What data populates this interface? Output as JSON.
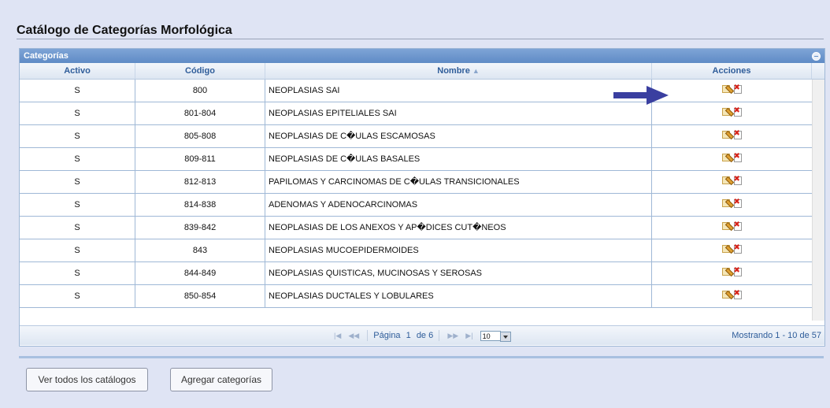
{
  "page": {
    "title": "Catálogo de Categorías Morfológica"
  },
  "grid": {
    "caption": "Categorías",
    "columns": {
      "activo": "Activo",
      "codigo": "Código",
      "nombre": "Nombre",
      "acciones": "Acciones"
    },
    "sorted_column": "nombre",
    "sort_direction": "asc",
    "rows": [
      {
        "activo": "S",
        "codigo": "800",
        "nombre": "NEOPLASIAS SAI"
      },
      {
        "activo": "S",
        "codigo": "801-804",
        "nombre": "NEOPLASIAS EPITELIALES SAI"
      },
      {
        "activo": "S",
        "codigo": "805-808",
        "nombre": "NEOPLASIAS DE C�ULAS ESCAMOSAS"
      },
      {
        "activo": "S",
        "codigo": "809-811",
        "nombre": "NEOPLASIAS DE C�ULAS BASALES"
      },
      {
        "activo": "S",
        "codigo": "812-813",
        "nombre": "PAPILOMAS Y CARCINOMAS DE C�ULAS TRANSICIONALES"
      },
      {
        "activo": "S",
        "codigo": "814-838",
        "nombre": "ADENOMAS Y ADENOCARCINOMAS"
      },
      {
        "activo": "S",
        "codigo": "839-842",
        "nombre": "NEOPLASIAS DE LOS ANEXOS Y AP�DICES CUT�NEOS"
      },
      {
        "activo": "S",
        "codigo": "843",
        "nombre": "NEOPLASIAS MUCOEPIDERMOIDES"
      },
      {
        "activo": "S",
        "codigo": "844-849",
        "nombre": "NEOPLASIAS QUISTICAS, MUCINOSAS Y SEROSAS"
      },
      {
        "activo": "S",
        "codigo": "850-854",
        "nombre": "NEOPLASIAS DUCTALES Y LOBULARES"
      }
    ],
    "pager": {
      "first_icon": "first-page-icon",
      "prev_icon": "prev-page-icon",
      "page_label": "Página",
      "current_page": "1",
      "of_label": "de",
      "total_pages": "6",
      "next_icon": "next-page-icon",
      "last_icon": "last-page-icon",
      "rows_per_page": "10",
      "summary": "Mostrando 1 - 10 de 57"
    }
  },
  "buttons": {
    "view_all": "Ver todos los catálogos",
    "add": "Agregar categorías"
  },
  "annotation": {
    "arrow_icon": "arrow-right-icon",
    "arrow_color": "#3a3fa0"
  }
}
